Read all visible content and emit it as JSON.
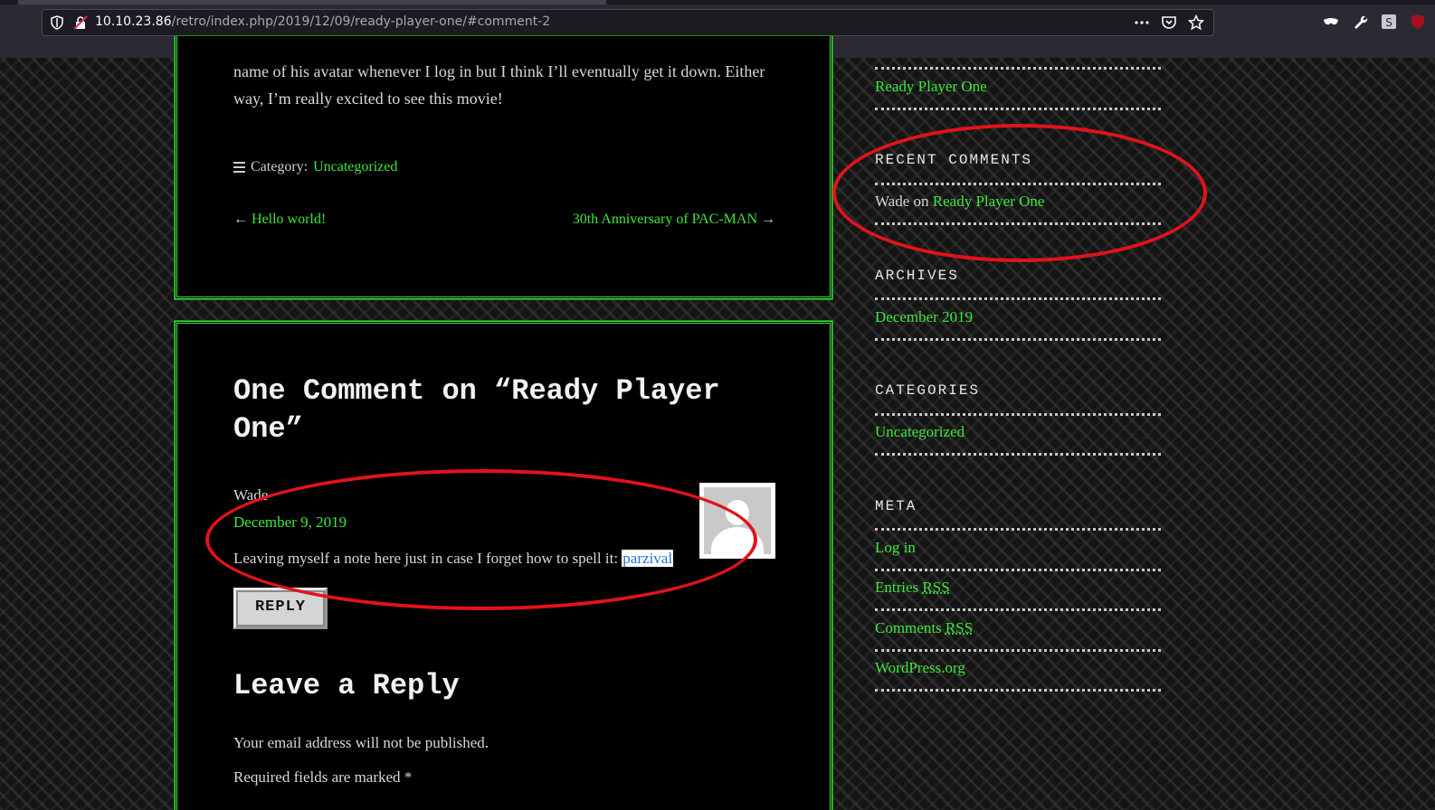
{
  "browser": {
    "url_host": "10.10.23.86",
    "url_path": "/retro/index.php/2019/12/09/ready-player-one/#comment-2"
  },
  "post": {
    "text": "name of his avatar whenever I log in but I think I’ll eventually get it down. Either way, I’m really excited to see this movie!",
    "category_label": "Category:",
    "category_value": "Uncategorized",
    "prev_arrow": "←",
    "prev_link": "Hello world!",
    "next_link": "30th Anniversary of PAC-MAN",
    "next_arrow": "→"
  },
  "comments": {
    "title": "One Comment on “Ready Player One”",
    "author": "Wade",
    "date": "December 9, 2019",
    "body_prefix": "Leaving myself a note here just in case I forget how to spell it: ",
    "body_highlight": "parzival",
    "reply_label": "REPLY"
  },
  "reply_form": {
    "title": "Leave a Reply",
    "email_note": "Your email address will not be published.",
    "required_note": "Required fields are marked *"
  },
  "sidebar": {
    "recent_posts_item": "Ready Player One",
    "recent_comments_title": "RECENT COMMENTS",
    "recent_comment_author": "Wade",
    "recent_comment_on": "on",
    "recent_comment_link": "Ready Player One",
    "archives_title": "ARCHIVES",
    "archives_item": "December 2019",
    "categories_title": "CATEGORIES",
    "categories_item": "Uncategorized",
    "meta_title": "META",
    "meta_login": "Log in",
    "meta_entries": "Entries",
    "meta_comments": "Comments",
    "meta_rss": "RSS",
    "meta_wordpress": "WordPress.org"
  },
  "colors": {
    "link_green": "#3ee83a",
    "annotation_red": "#e3121b"
  }
}
